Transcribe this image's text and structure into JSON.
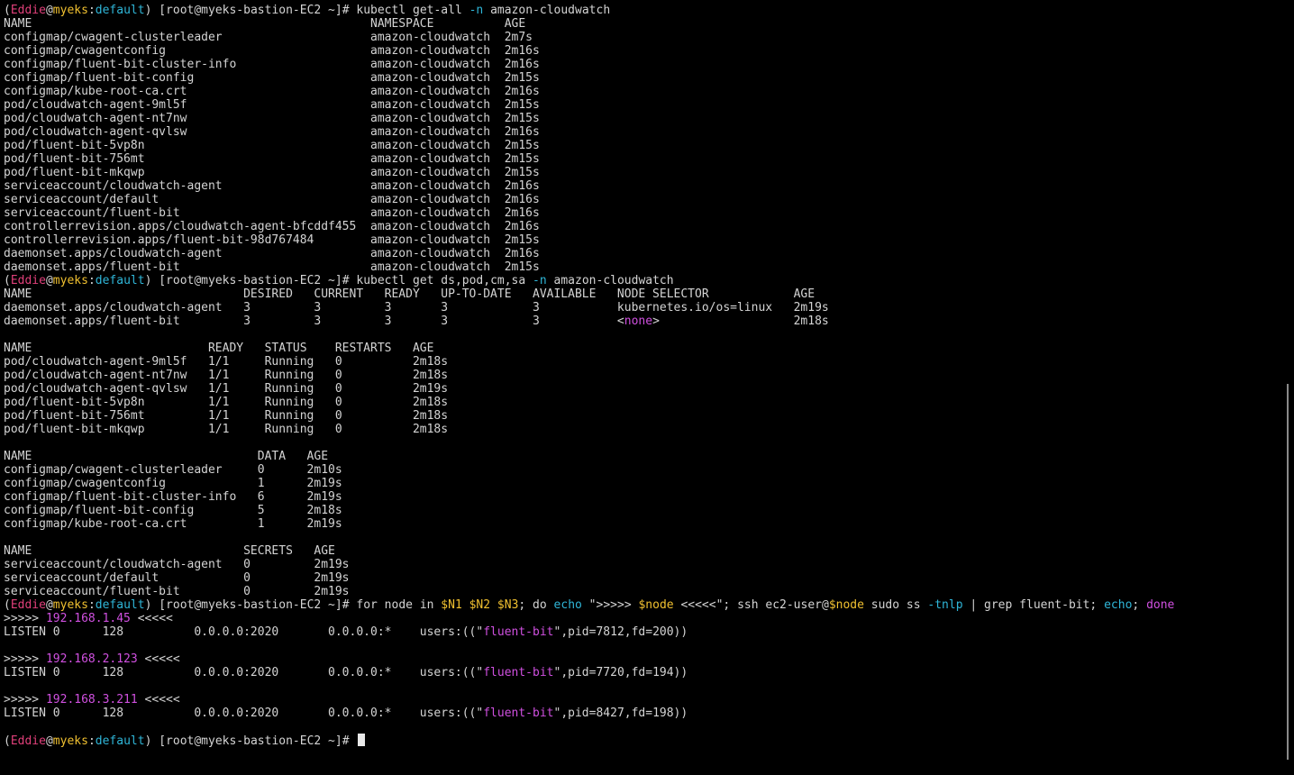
{
  "colors": {
    "default": "#d4d4d4",
    "user": "#e0407a",
    "host": "#f0c030",
    "ctx": "#2fb6d8",
    "flag": "#2fb6d8",
    "var": "#f0c030",
    "magenta": "#d050e0",
    "kw": "#d050e0"
  },
  "prompt": {
    "open": "(",
    "user": "Eddie",
    "at": "@",
    "host": "myeks",
    "colon": ":",
    "context": "default",
    "close": ")",
    "rest": " [root@myeks-bastion-EC2 ~]# "
  },
  "scroll": {
    "thumb_fraction_start": 0.495,
    "thumb_fraction_size": 0.485
  },
  "lines": [
    {
      "prompt": true,
      "segs": [
        [
          "kubectl get-all ",
          "default"
        ],
        [
          "-n",
          "flag"
        ],
        [
          " amazon-cloudwatch",
          "default"
        ]
      ]
    },
    {
      "segs": [
        [
          "NAME                                                NAMESPACE          AGE",
          "default"
        ]
      ]
    },
    {
      "segs": [
        [
          "configmap/cwagent-clusterleader                     amazon-cloudwatch  2m7s",
          "default"
        ]
      ]
    },
    {
      "segs": [
        [
          "configmap/cwagentconfig                             amazon-cloudwatch  2m16s",
          "default"
        ]
      ]
    },
    {
      "segs": [
        [
          "configmap/fluent-bit-cluster-info                   amazon-cloudwatch  2m16s",
          "default"
        ]
      ]
    },
    {
      "segs": [
        [
          "configmap/fluent-bit-config                         amazon-cloudwatch  2m15s",
          "default"
        ]
      ]
    },
    {
      "segs": [
        [
          "configmap/kube-root-ca.crt                          amazon-cloudwatch  2m16s",
          "default"
        ]
      ]
    },
    {
      "segs": [
        [
          "pod/cloudwatch-agent-9ml5f                          amazon-cloudwatch  2m15s",
          "default"
        ]
      ]
    },
    {
      "segs": [
        [
          "pod/cloudwatch-agent-nt7nw                          amazon-cloudwatch  2m15s",
          "default"
        ]
      ]
    },
    {
      "segs": [
        [
          "pod/cloudwatch-agent-qvlsw                          amazon-cloudwatch  2m16s",
          "default"
        ]
      ]
    },
    {
      "segs": [
        [
          "pod/fluent-bit-5vp8n                                amazon-cloudwatch  2m15s",
          "default"
        ]
      ]
    },
    {
      "segs": [
        [
          "pod/fluent-bit-756mt                                amazon-cloudwatch  2m15s",
          "default"
        ]
      ]
    },
    {
      "segs": [
        [
          "pod/fluent-bit-mkqwp                                amazon-cloudwatch  2m15s",
          "default"
        ]
      ]
    },
    {
      "segs": [
        [
          "serviceaccount/cloudwatch-agent                     amazon-cloudwatch  2m16s",
          "default"
        ]
      ]
    },
    {
      "segs": [
        [
          "serviceaccount/default                              amazon-cloudwatch  2m16s",
          "default"
        ]
      ]
    },
    {
      "segs": [
        [
          "serviceaccount/fluent-bit                           amazon-cloudwatch  2m16s",
          "default"
        ]
      ]
    },
    {
      "segs": [
        [
          "controllerrevision.apps/cloudwatch-agent-bfcddf455  amazon-cloudwatch  2m16s",
          "default"
        ]
      ]
    },
    {
      "segs": [
        [
          "controllerrevision.apps/fluent-bit-98d767484        amazon-cloudwatch  2m15s",
          "default"
        ]
      ]
    },
    {
      "segs": [
        [
          "daemonset.apps/cloudwatch-agent                     amazon-cloudwatch  2m16s",
          "default"
        ]
      ]
    },
    {
      "segs": [
        [
          "daemonset.apps/fluent-bit                           amazon-cloudwatch  2m15s",
          "default"
        ]
      ]
    },
    {
      "prompt": true,
      "segs": [
        [
          "kubectl get ds,pod,cm,sa ",
          "default"
        ],
        [
          "-n",
          "flag"
        ],
        [
          " amazon-cloudwatch",
          "default"
        ]
      ]
    },
    {
      "segs": [
        [
          "NAME                              DESIRED   CURRENT   READY   UP-TO-DATE   AVAILABLE   NODE SELECTOR            AGE",
          "default"
        ]
      ]
    },
    {
      "segs": [
        [
          "daemonset.apps/cloudwatch-agent   3         3         3       3            3           kubernetes.io/os=linux   2m19s",
          "default"
        ]
      ]
    },
    {
      "segs": [
        [
          "daemonset.apps/fluent-bit         3         3         3       3            3           <",
          "default"
        ],
        [
          "none",
          "magenta"
        ],
        [
          ">                   2m18s",
          "default"
        ]
      ]
    },
    {
      "segs": [
        [
          "",
          "default"
        ]
      ]
    },
    {
      "segs": [
        [
          "NAME                         READY   STATUS    RESTARTS   AGE",
          "default"
        ]
      ]
    },
    {
      "segs": [
        [
          "pod/cloudwatch-agent-9ml5f   1/1     Running   0          2m18s",
          "default"
        ]
      ]
    },
    {
      "segs": [
        [
          "pod/cloudwatch-agent-nt7nw   1/1     Running   0          2m18s",
          "default"
        ]
      ]
    },
    {
      "segs": [
        [
          "pod/cloudwatch-agent-qvlsw   1/1     Running   0          2m19s",
          "default"
        ]
      ]
    },
    {
      "segs": [
        [
          "pod/fluent-bit-5vp8n         1/1     Running   0          2m18s",
          "default"
        ]
      ]
    },
    {
      "segs": [
        [
          "pod/fluent-bit-756mt         1/1     Running   0          2m18s",
          "default"
        ]
      ]
    },
    {
      "segs": [
        [
          "pod/fluent-bit-mkqwp         1/1     Running   0          2m18s",
          "default"
        ]
      ]
    },
    {
      "segs": [
        [
          "",
          "default"
        ]
      ]
    },
    {
      "segs": [
        [
          "NAME                                DATA   AGE",
          "default"
        ]
      ]
    },
    {
      "segs": [
        [
          "configmap/cwagent-clusterleader     0      2m10s",
          "default"
        ]
      ]
    },
    {
      "segs": [
        [
          "configmap/cwagentconfig             1      2m19s",
          "default"
        ]
      ]
    },
    {
      "segs": [
        [
          "configmap/fluent-bit-cluster-info   6      2m19s",
          "default"
        ]
      ]
    },
    {
      "segs": [
        [
          "configmap/fluent-bit-config         5      2m18s",
          "default"
        ]
      ]
    },
    {
      "segs": [
        [
          "configmap/kube-root-ca.crt          1      2m19s",
          "default"
        ]
      ]
    },
    {
      "segs": [
        [
          "",
          "default"
        ]
      ]
    },
    {
      "segs": [
        [
          "NAME                              SECRETS   AGE",
          "default"
        ]
      ]
    },
    {
      "segs": [
        [
          "serviceaccount/cloudwatch-agent   0         2m19s",
          "default"
        ]
      ]
    },
    {
      "segs": [
        [
          "serviceaccount/default            0         2m19s",
          "default"
        ]
      ]
    },
    {
      "segs": [
        [
          "serviceaccount/fluent-bit         0         2m19s",
          "default"
        ]
      ]
    },
    {
      "prompt": true,
      "segs": [
        [
          "for node in ",
          "default"
        ],
        [
          "$N1",
          "var"
        ],
        [
          " ",
          "default"
        ],
        [
          "$N2",
          "var"
        ],
        [
          " ",
          "default"
        ],
        [
          "$N3",
          "var"
        ],
        [
          "; do ",
          "default"
        ],
        [
          "echo",
          "ctx"
        ],
        [
          " \">>>>> ",
          "default"
        ],
        [
          "$node",
          "var"
        ],
        [
          " <<<<<\"; ssh ec2-user@",
          "default"
        ],
        [
          "$node",
          "var"
        ],
        [
          " sudo ss ",
          "default"
        ],
        [
          "-tnlp",
          "flag"
        ],
        [
          " | grep fluent-bit; ",
          "default"
        ],
        [
          "echo",
          "ctx"
        ],
        [
          "; ",
          "default"
        ],
        [
          "done",
          "kw"
        ]
      ]
    },
    {
      "segs": [
        [
          ">>>>> ",
          "default"
        ],
        [
          "192.168.1.45",
          "magenta"
        ],
        [
          " <<<<<",
          "default"
        ]
      ]
    },
    {
      "segs": [
        [
          "LISTEN 0      128          0.0.0.0:2020       0.0.0.0:*    users:((\"",
          "default"
        ],
        [
          "fluent-bit",
          "magenta"
        ],
        [
          "\",pid=7812,fd=200))",
          "default"
        ]
      ]
    },
    {
      "segs": [
        [
          "",
          "default"
        ]
      ]
    },
    {
      "segs": [
        [
          ">>>>> ",
          "default"
        ],
        [
          "192.168.2.123",
          "magenta"
        ],
        [
          " <<<<<",
          "default"
        ]
      ]
    },
    {
      "segs": [
        [
          "LISTEN 0      128          0.0.0.0:2020       0.0.0.0:*    users:((\"",
          "default"
        ],
        [
          "fluent-bit",
          "magenta"
        ],
        [
          "\",pid=7720,fd=194))",
          "default"
        ]
      ]
    },
    {
      "segs": [
        [
          "",
          "default"
        ]
      ]
    },
    {
      "segs": [
        [
          ">>>>> ",
          "default"
        ],
        [
          "192.168.3.211",
          "magenta"
        ],
        [
          " <<<<<",
          "default"
        ]
      ]
    },
    {
      "segs": [
        [
          "LISTEN 0      128          0.0.0.0:2020       0.0.0.0:*    users:((\"",
          "default"
        ],
        [
          "fluent-bit",
          "magenta"
        ],
        [
          "\",pid=8427,fd=198))",
          "default"
        ]
      ]
    },
    {
      "segs": [
        [
          "",
          "default"
        ]
      ]
    },
    {
      "prompt": true,
      "cursor": true,
      "segs": []
    }
  ]
}
